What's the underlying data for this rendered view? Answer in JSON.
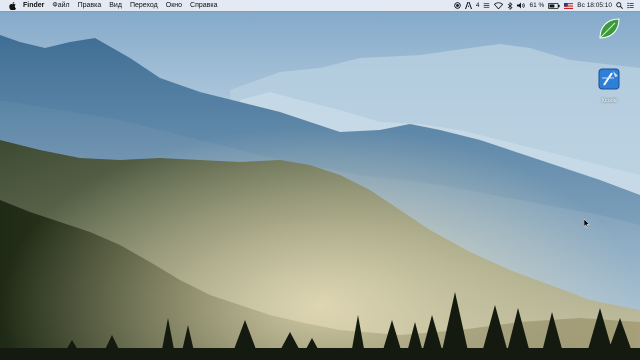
{
  "menubar": {
    "app_name": "Finder",
    "menus": [
      "Файл",
      "Правка",
      "Вид",
      "Переход",
      "Окно",
      "Справка"
    ],
    "status": {
      "input_count": "4",
      "battery_percent": "61 %",
      "clock": "Вс 18:05:10"
    },
    "icons": [
      "apple-icon",
      "record-icon",
      "adobe-icon",
      "wifi-icon",
      "bluetooth-icon",
      "volume-icon",
      "battery-icon",
      "flag-us-icon",
      "spotlight-icon",
      "list-icon"
    ]
  },
  "desktop": {
    "icons": [
      {
        "name": "leaf-app-icon",
        "label": ""
      },
      {
        "name": "xcode-icon",
        "label": "Xcode"
      }
    ]
  },
  "colors": {
    "sky_top": "#7fa6c8",
    "haze": "#d9e6ee",
    "forest": "#2f3a22"
  }
}
